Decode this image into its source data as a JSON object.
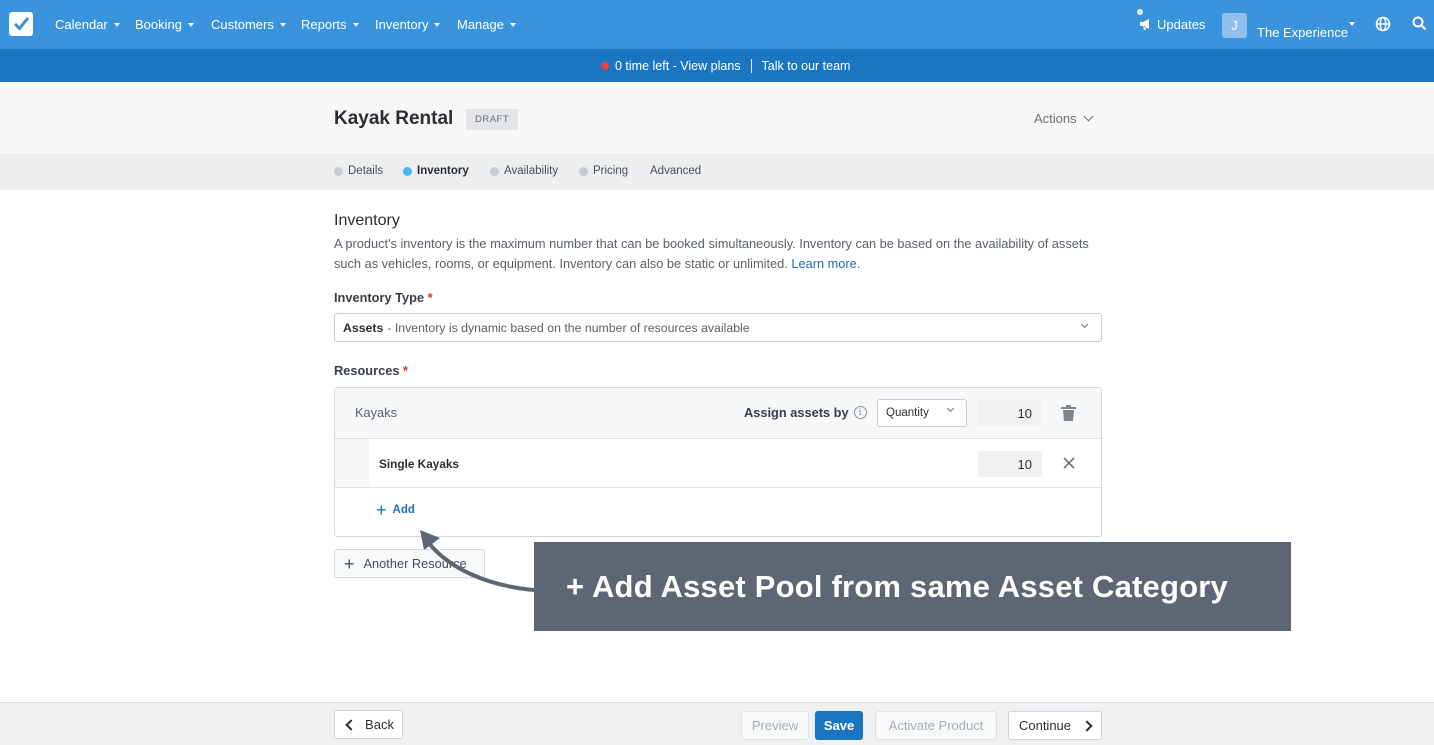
{
  "topnav": {
    "menu": [
      {
        "label": "Calendar"
      },
      {
        "label": "Booking"
      },
      {
        "label": "Customers"
      },
      {
        "label": "Reports"
      },
      {
        "label": "Inventory"
      },
      {
        "label": "Manage"
      }
    ],
    "updates_label": "Updates",
    "avatar_initial": "J",
    "account_name": "The Experience"
  },
  "plans_bar": {
    "time_left": "0 time left - View plans",
    "talk": "Talk to our team"
  },
  "product": {
    "title": "Kayak Rental",
    "status_badge": "DRAFT",
    "actions_label": "Actions"
  },
  "tabs": [
    {
      "label": "Details",
      "state": "default"
    },
    {
      "label": "Inventory",
      "state": "active"
    },
    {
      "label": "Availability",
      "state": "default"
    },
    {
      "label": "Pricing",
      "state": "default"
    },
    {
      "label": "Advanced",
      "state": "none"
    }
  ],
  "inventory": {
    "section_title": "Inventory",
    "description": "A product's inventory is the maximum number that can be booked simultaneously. Inventory can be based on the availability of assets such as vehicles, rooms, or equipment. Inventory can also be static or unlimited.",
    "learn_more": "Learn more",
    "type_label": "Inventory Type",
    "type_value_strong": "Assets",
    "type_value_rest": "- Inventory is dynamic based on the number of resources available",
    "resources_label": "Resources",
    "required_mark": "*"
  },
  "resource": {
    "name": "Kayaks",
    "assign_label": "Assign assets by",
    "assign_select": "Quantity",
    "total_qty": "10",
    "sub_items": [
      {
        "name": "Single Kayaks",
        "qty": "10"
      }
    ],
    "add_label": "Add"
  },
  "another_resource_label": "Another Resource",
  "callout_text": "+ Add Asset Pool from same Asset Category",
  "footer": {
    "back": "Back",
    "preview": "Preview",
    "save": "Save",
    "activate": "Activate Product",
    "continue": "Continue"
  },
  "colors": {
    "nav_bg": "#3a93dd",
    "plans_bg": "#1b76c2",
    "accent": "#1b76c2",
    "active_tab_dot": "#48b6ec",
    "callout_bg": "#5d6672",
    "required": "#d93025"
  }
}
